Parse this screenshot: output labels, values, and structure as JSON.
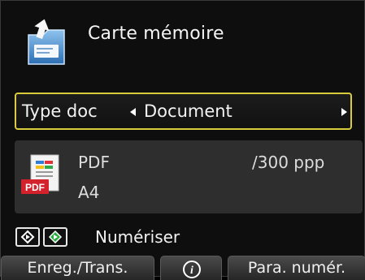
{
  "header": {
    "title": "Carte mémoire",
    "icon": "memory-card-icon"
  },
  "doc_type": {
    "label": "Type doc",
    "value": "Document",
    "accent_color": "#d9cc3c"
  },
  "settings": {
    "icon": "pdf-file-icon",
    "icon_badge": "PDF",
    "format": "PDF",
    "resolution": "/300 ppp",
    "paper_size": "A4"
  },
  "scan_hint": {
    "label": "Numériser",
    "keys": [
      "black-start-icon",
      "color-start-icon"
    ]
  },
  "softkeys": {
    "left_label": "Enreg./Trans.",
    "center_icon": "info-icon",
    "center_glyph": "i",
    "right_label": "Para. numér."
  }
}
